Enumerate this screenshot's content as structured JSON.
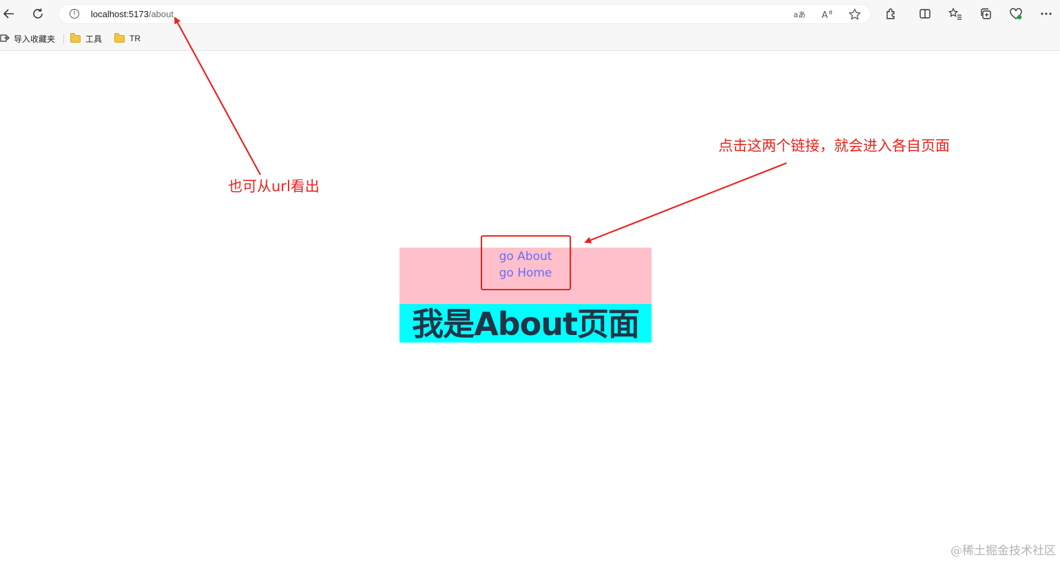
{
  "browser": {
    "url_host": "localhost:5173",
    "url_path": "/about",
    "bookmarks": [
      {
        "label": "导入收藏夹",
        "icon": "import-favorites-icon"
      },
      {
        "label": "工具",
        "icon": "folder-icon"
      },
      {
        "label": "TR",
        "icon": "folder-icon"
      }
    ]
  },
  "page": {
    "nav": {
      "about_link": "go About",
      "home_link": "go Home"
    },
    "title": "我是About页面"
  },
  "annotations": {
    "url_note": "也可从url看出",
    "links_note": "点击这两个链接，就会进入各自页面",
    "color": "#e8231e"
  },
  "watermark": "@稀土掘金技术社区",
  "colors": {
    "nav_background": "#ffc0cb",
    "title_background": "#00ffff",
    "link_color": "#646cff",
    "title_color": "#213547"
  }
}
